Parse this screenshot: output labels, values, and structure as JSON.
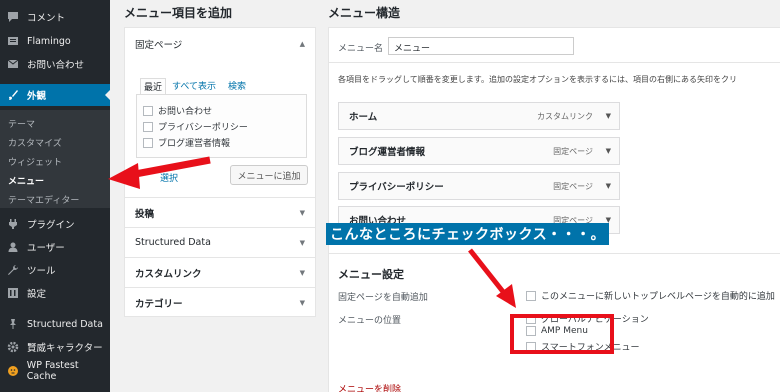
{
  "sidebar": {
    "items": [
      {
        "label": "コメント",
        "icon": "comment-icon"
      },
      {
        "label": "Flamingo",
        "icon": "flamingo-icon"
      },
      {
        "label": "お問い合わせ",
        "icon": "mail-icon"
      },
      {
        "label": "外観",
        "icon": "paintbrush-icon"
      },
      {
        "label": "プラグイン",
        "icon": "plugin-icon"
      },
      {
        "label": "ユーザー",
        "icon": "user-icon"
      },
      {
        "label": "ツール",
        "icon": "wrench-icon"
      },
      {
        "label": "設定",
        "icon": "settings-icon"
      },
      {
        "label": "Structured Data",
        "icon": "pin-icon"
      },
      {
        "label": "賢威キャラクター",
        "icon": "gear-icon"
      },
      {
        "label": "WP Fastest Cache",
        "icon": "cheetah-icon"
      }
    ],
    "submenu": [
      "テーマ",
      "カスタマイズ",
      "ウィジェット",
      "メニュー",
      "テーマエディター"
    ]
  },
  "add_items": {
    "heading": "メニュー項目を追加",
    "fixed_pages": {
      "title": "固定ページ",
      "tabs": [
        "最近",
        "すべて表示",
        "検索"
      ],
      "pages": [
        "お問い合わせ",
        "プライバシーポリシー",
        "ブログ運営者情報"
      ],
      "select_all": "選択",
      "add_button": "メニューに追加"
    },
    "sections": [
      "投稿",
      "Structured Data",
      "カスタムリンク",
      "カテゴリー"
    ]
  },
  "structure": {
    "heading": "メニュー構造",
    "name_label": "メニュー名",
    "name_value": "メニュー",
    "instruction": "各項目をドラッグして順番を変更します。追加の設定オプションを表示するには、項目の右側にある矢印をクリ",
    "items": [
      {
        "title": "ホーム",
        "type": "カスタムリンク"
      },
      {
        "title": "ブログ運営者情報",
        "type": "固定ページ"
      },
      {
        "title": "プライバシーポリシー",
        "type": "固定ページ"
      },
      {
        "title": "お問い合わせ",
        "type": "固定ページ"
      }
    ]
  },
  "settings": {
    "heading": "メニュー設定",
    "auto_add_label": "固定ページを自動追加",
    "auto_add_option": "このメニューに新しいトップレベルページを自動的に追加",
    "location_label": "メニューの位置",
    "locations": [
      "グローバルナビゲーション",
      "AMP Menu",
      "スマートフォンメニュー"
    ],
    "delete_link": "メニューを削除"
  },
  "annotation": {
    "text": "こんなところにチェックボックス・・・。"
  },
  "colors": {
    "accent": "#0073aa",
    "sidebar": "#23282d",
    "red": "#e8101a"
  }
}
